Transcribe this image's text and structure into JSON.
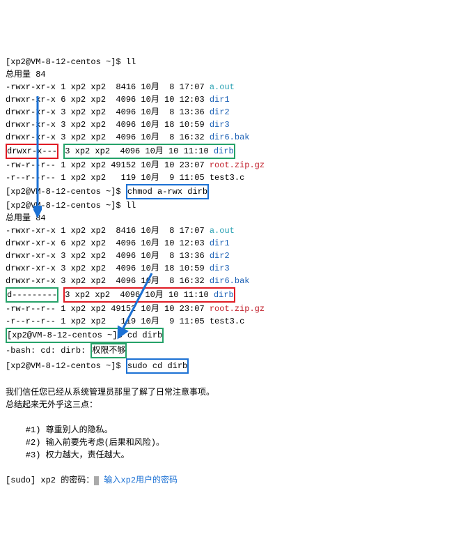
{
  "prompt": "[xp2@VM-8-12-centos ~]$ ",
  "cmds": {
    "ll1": "ll",
    "chmod": "chmod a-rwx dirb",
    "ll2": "ll",
    "cd": "cd dirb",
    "sudo_cd": "sudo cd dirb"
  },
  "total_label": "总用量 ",
  "total_value": "84",
  "listing_a": [
    {
      "perm": "-rwxr-xr-x",
      "links": "1",
      "owner": "xp2",
      "group": "xp2",
      "size": "8416",
      "month": "10月",
      "day": " 8",
      "time": "17:07",
      "name": "a.out",
      "cls": "cyan"
    },
    {
      "perm": "drwxr-xr-x",
      "links": "6",
      "owner": "xp2",
      "group": "xp2",
      "size": "4096",
      "month": "10月",
      "day": "10",
      "time": "12:03",
      "name": "dir1",
      "cls": "blue"
    },
    {
      "perm": "drwxr-xr-x",
      "links": "3",
      "owner": "xp2",
      "group": "xp2",
      "size": "4096",
      "month": "10月",
      "day": " 8",
      "time": "13:36",
      "name": "dir2",
      "cls": "blue"
    },
    {
      "perm": "drwxr-xr-x",
      "links": "3",
      "owner": "xp2",
      "group": "xp2",
      "size": "4096",
      "month": "10月",
      "day": "18",
      "time": "10:59",
      "name": "dir3",
      "cls": "blue"
    },
    {
      "perm": "drwxr-xr-x",
      "links": "3",
      "owner": "xp2",
      "group": "xp2",
      "size": "4096",
      "month": "10月",
      "day": " 8",
      "time": "16:32",
      "name": "dir6.bak",
      "cls": "blue"
    }
  ],
  "dirb_a": {
    "perm": "drwxr-x---",
    "links": "3",
    "owner": "xp2",
    "group": "xp2",
    "size": "4096",
    "month": "10月",
    "day": "10",
    "time": "11:10",
    "name": "dirb",
    "cls": "blue"
  },
  "tail_a": [
    {
      "perm": "-rw-r--r--",
      "links": "1",
      "owner": "xp2",
      "group": "xp2",
      "size": "49152",
      "month": "10月",
      "day": "10",
      "time": "23:07",
      "name": "root.zip.gz",
      "cls": "red"
    },
    {
      "perm": "-r--r--r--",
      "links": "1",
      "owner": "xp2",
      "group": "xp2",
      "size": " 119",
      "month": "10月",
      "day": " 9",
      "time": "11:05",
      "name": "test3.c",
      "cls": ""
    }
  ],
  "listing_b": [
    {
      "perm": "-rwxr-xr-x",
      "links": "1",
      "owner": "xp2",
      "group": "xp2",
      "size": "8416",
      "month": "10月",
      "day": " 8",
      "time": "17:07",
      "name": "a.out",
      "cls": "cyan"
    },
    {
      "perm": "drwxr-xr-x",
      "links": "6",
      "owner": "xp2",
      "group": "xp2",
      "size": "4096",
      "month": "10月",
      "day": "10",
      "time": "12:03",
      "name": "dir1",
      "cls": "blue"
    },
    {
      "perm": "drwxr-xr-x",
      "links": "3",
      "owner": "xp2",
      "group": "xp2",
      "size": "4096",
      "month": "10月",
      "day": " 8",
      "time": "13:36",
      "name": "dir2",
      "cls": "blue"
    },
    {
      "perm": "drwxr-xr-x",
      "links": "3",
      "owner": "xp2",
      "group": "xp2",
      "size": "4096",
      "month": "10月",
      "day": "18",
      "time": "10:59",
      "name": "dir3",
      "cls": "blue"
    },
    {
      "perm": "drwxr-xr-x",
      "links": "3",
      "owner": "xp2",
      "group": "xp2",
      "size": "4096",
      "month": "10月",
      "day": " 8",
      "time": "16:32",
      "name": "dir6.bak",
      "cls": "blue"
    }
  ],
  "dirb_b": {
    "perm": "d---------",
    "links": "3",
    "owner": "xp2",
    "group": "xp2",
    "size": "4096",
    "month": "10月",
    "day": "10",
    "time": "11:10",
    "name": "dirb",
    "cls": "blue"
  },
  "tail_b": [
    {
      "perm": "-rw-r--r--",
      "links": "1",
      "owner": "xp2",
      "group": "xp2",
      "size": "49152",
      "month": "10月",
      "day": "10",
      "time": "23:07",
      "name": "root.zip.gz",
      "cls": "red"
    },
    {
      "perm": "-r--r--r--",
      "links": "1",
      "owner": "xp2",
      "group": "xp2",
      "size": " 119",
      "month": "10月",
      "day": " 9",
      "time": "11:05",
      "name": "test3.c",
      "cls": ""
    }
  ],
  "err": {
    "prefix": "-bash: cd: dirb: ",
    "msg": "权限不够"
  },
  "sudo_lecture": {
    "l1": "我们信任您已经从系统管理员那里了解了日常注意事项。",
    "l2": "总结起来无外乎这三点：",
    "p1": "    #1) 尊重别人的隐私。",
    "p2": "    #2) 输入前要先考虑(后果和风险)。",
    "p3": "    #3) 权力越大，责任越大。"
  },
  "sudo_pw": {
    "label": "[sudo] xp2 的密码：",
    "note": "输入xp2用户的密码"
  }
}
